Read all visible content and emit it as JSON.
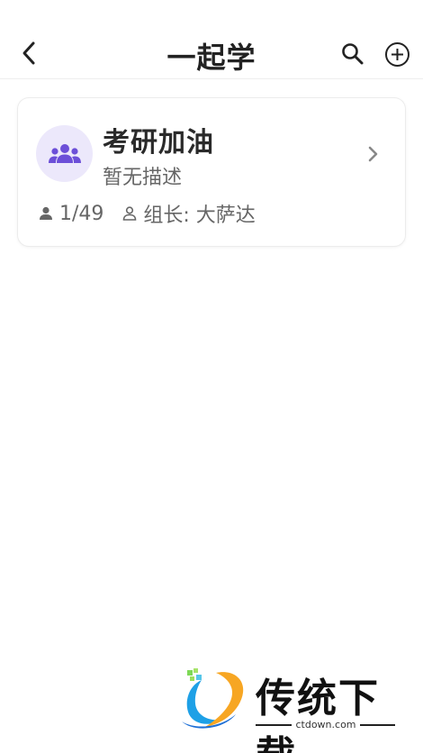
{
  "header": {
    "title": "一起学",
    "back_icon": "chevron-left-icon",
    "search_icon": "search-icon",
    "add_icon": "plus-circle-icon"
  },
  "group": {
    "name": "考研加油",
    "description": "暂无描述",
    "members": "1/49",
    "leader": "组长: 大萨达",
    "avatar_icon": "group-people-icon",
    "accent_color": "#6c4fd8",
    "avatar_bg": "#ece8fb"
  },
  "watermark": {
    "title": "传统下载",
    "subtitle": "ctdown.com"
  }
}
